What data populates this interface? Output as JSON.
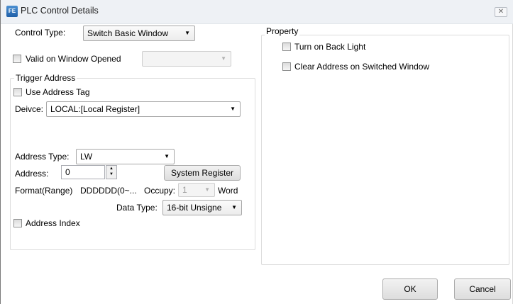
{
  "window": {
    "title": "PLC Control Details",
    "app_icon": "FE",
    "close_glyph": "✕"
  },
  "control_type": {
    "label": "Control Type:",
    "value": "Switch Basic Window"
  },
  "valid_on_window_opened": {
    "label": "Valid on Window Opened",
    "value": ""
  },
  "trigger_address": {
    "title": "Trigger Address",
    "use_address_tag_label": "Use Address Tag",
    "device_label": "Deivce:",
    "device_value": "LOCAL:[Local Register]",
    "address_type_label": "Address Type:",
    "address_type_value": "LW",
    "address_label": "Address:",
    "address_value": "0",
    "system_register_label": "System Register",
    "format_label": "Format(Range)",
    "format_value": "DDDDDD(0~...",
    "occupy_label": "Occupy:",
    "occupy_value": "1",
    "occupy_unit": "Word",
    "data_type_label": "Data Type:",
    "data_type_value": "16-bit Unsigne",
    "address_index_label": "Address Index"
  },
  "property": {
    "title": "Property",
    "turn_on_back_light_label": "Turn on Back Light",
    "clear_address_label": "Clear Address on Switched Window"
  },
  "footer": {
    "ok_label": "OK",
    "cancel_label": "Cancel"
  }
}
